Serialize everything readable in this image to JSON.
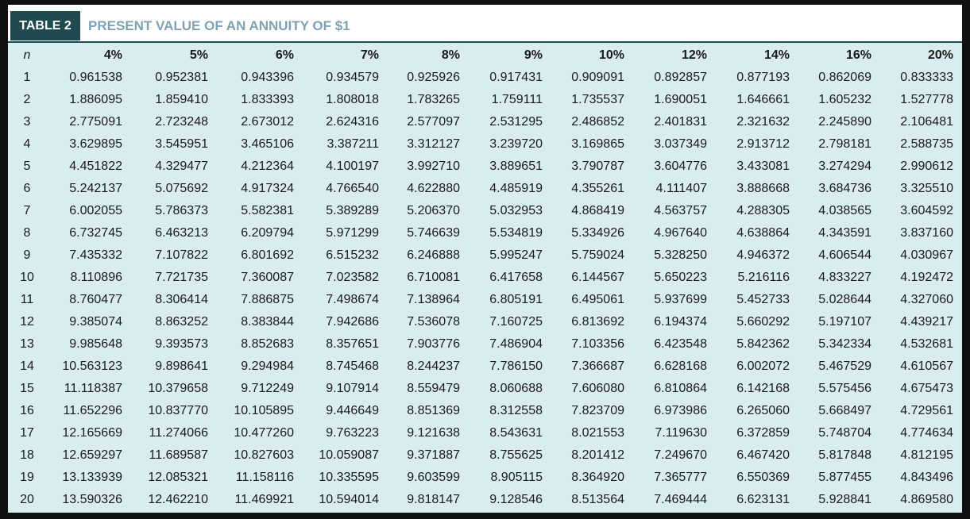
{
  "title": {
    "tag": "TABLE 2",
    "text": "PRESENT VALUE OF AN ANNUITY OF $1"
  },
  "table": {
    "headers": [
      "n",
      "4%",
      "5%",
      "6%",
      "7%",
      "8%",
      "9%",
      "10%",
      "12%",
      "14%",
      "16%",
      "20%"
    ],
    "rows": [
      [
        "1",
        "0.961538",
        "0.952381",
        "0.943396",
        "0.934579",
        "0.925926",
        "0.917431",
        "0.909091",
        "0.892857",
        "0.877193",
        "0.862069",
        "0.833333"
      ],
      [
        "2",
        "1.886095",
        "1.859410",
        "1.833393",
        "1.808018",
        "1.783265",
        "1.759111",
        "1.735537",
        "1.690051",
        "1.646661",
        "1.605232",
        "1.527778"
      ],
      [
        "3",
        "2.775091",
        "2.723248",
        "2.673012",
        "2.624316",
        "2.577097",
        "2.531295",
        "2.486852",
        "2.401831",
        "2.321632",
        "2.245890",
        "2.106481"
      ],
      [
        "4",
        "3.629895",
        "3.545951",
        "3.465106",
        "3.387211",
        "3.312127",
        "3.239720",
        "3.169865",
        "3.037349",
        "2.913712",
        "2.798181",
        "2.588735"
      ],
      [
        "5",
        "4.451822",
        "4.329477",
        "4.212364",
        "4.100197",
        "3.992710",
        "3.889651",
        "3.790787",
        "3.604776",
        "3.433081",
        "3.274294",
        "2.990612"
      ],
      [
        "6",
        "5.242137",
        "5.075692",
        "4.917324",
        "4.766540",
        "4.622880",
        "4.485919",
        "4.355261",
        "4.111407",
        "3.888668",
        "3.684736",
        "3.325510"
      ],
      [
        "7",
        "6.002055",
        "5.786373",
        "5.582381",
        "5.389289",
        "5.206370",
        "5.032953",
        "4.868419",
        "4.563757",
        "4.288305",
        "4.038565",
        "3.604592"
      ],
      [
        "8",
        "6.732745",
        "6.463213",
        "6.209794",
        "5.971299",
        "5.746639",
        "5.534819",
        "5.334926",
        "4.967640",
        "4.638864",
        "4.343591",
        "3.837160"
      ],
      [
        "9",
        "7.435332",
        "7.107822",
        "6.801692",
        "6.515232",
        "6.246888",
        "5.995247",
        "5.759024",
        "5.328250",
        "4.946372",
        "4.606544",
        "4.030967"
      ],
      [
        "10",
        "8.110896",
        "7.721735",
        "7.360087",
        "7.023582",
        "6.710081",
        "6.417658",
        "6.144567",
        "5.650223",
        "5.216116",
        "4.833227",
        "4.192472"
      ],
      [
        "11",
        "8.760477",
        "8.306414",
        "7.886875",
        "7.498674",
        "7.138964",
        "6.805191",
        "6.495061",
        "5.937699",
        "5.452733",
        "5.028644",
        "4.327060"
      ],
      [
        "12",
        "9.385074",
        "8.863252",
        "8.383844",
        "7.942686",
        "7.536078",
        "7.160725",
        "6.813692",
        "6.194374",
        "5.660292",
        "5.197107",
        "4.439217"
      ],
      [
        "13",
        "9.985648",
        "9.393573",
        "8.852683",
        "8.357651",
        "7.903776",
        "7.486904",
        "7.103356",
        "6.423548",
        "5.842362",
        "5.342334",
        "4.532681"
      ],
      [
        "14",
        "10.563123",
        "9.898641",
        "9.294984",
        "8.745468",
        "8.244237",
        "7.786150",
        "7.366687",
        "6.628168",
        "6.002072",
        "5.467529",
        "4.610567"
      ],
      [
        "15",
        "11.118387",
        "10.379658",
        "9.712249",
        "9.107914",
        "8.559479",
        "8.060688",
        "7.606080",
        "6.810864",
        "6.142168",
        "5.575456",
        "4.675473"
      ],
      [
        "16",
        "11.652296",
        "10.837770",
        "10.105895",
        "9.446649",
        "8.851369",
        "8.312558",
        "7.823709",
        "6.973986",
        "6.265060",
        "5.668497",
        "4.729561"
      ],
      [
        "17",
        "12.165669",
        "11.274066",
        "10.477260",
        "9.763223",
        "9.121638",
        "8.543631",
        "8.021553",
        "7.119630",
        "6.372859",
        "5.748704",
        "4.774634"
      ],
      [
        "18",
        "12.659297",
        "11.689587",
        "10.827603",
        "10.059087",
        "9.371887",
        "8.755625",
        "8.201412",
        "7.249670",
        "6.467420",
        "5.817848",
        "4.812195"
      ],
      [
        "19",
        "13.133939",
        "12.085321",
        "11.158116",
        "10.335595",
        "9.603599",
        "8.905115",
        "8.364920",
        "7.365777",
        "6.550369",
        "5.877455",
        "4.843496"
      ],
      [
        "20",
        "13.590326",
        "12.462210",
        "11.469921",
        "10.594014",
        "9.818147",
        "9.128546",
        "8.513564",
        "7.469444",
        "6.623131",
        "5.928841",
        "4.869580"
      ]
    ]
  },
  "colors": {
    "title_tag_bg": "#1f4a50",
    "title_text": "#7fa2b3",
    "table_bg": "#d9ecf0"
  }
}
